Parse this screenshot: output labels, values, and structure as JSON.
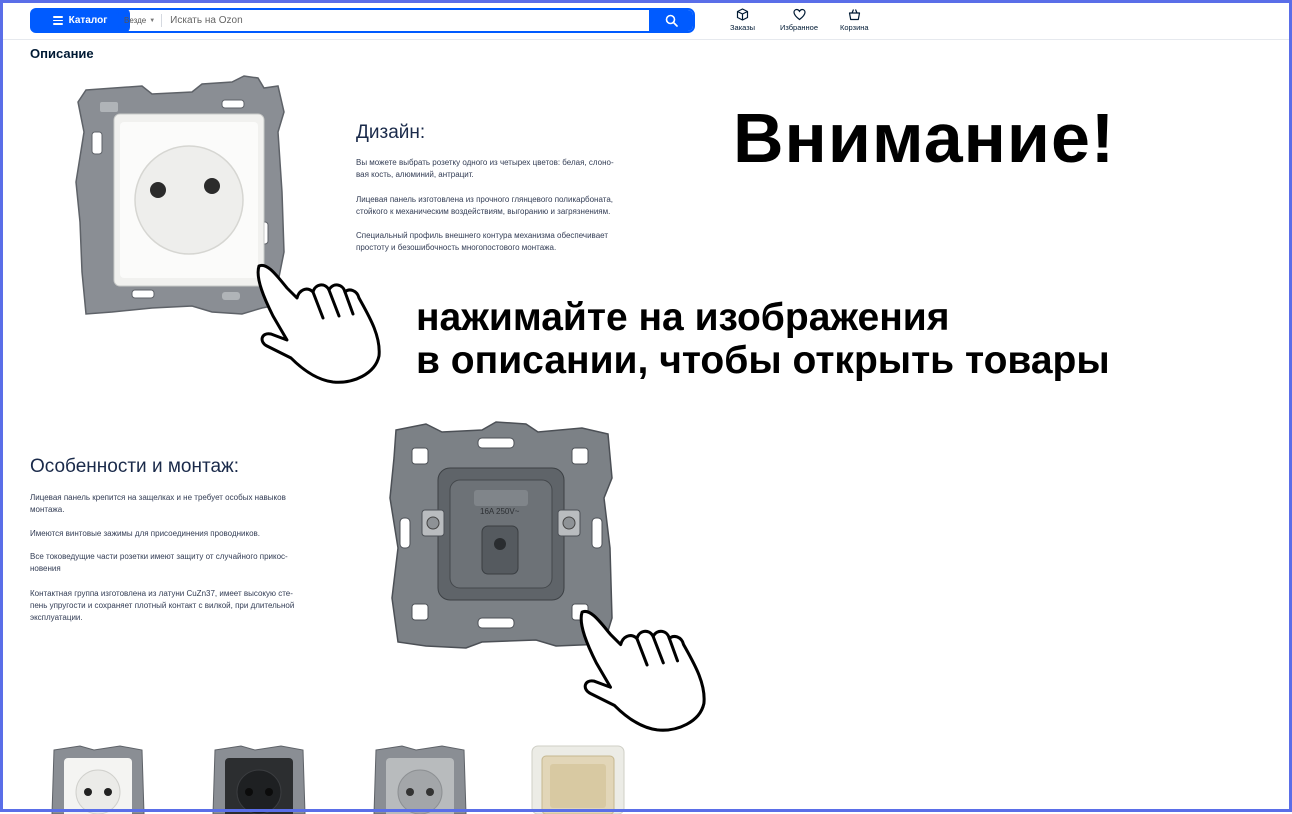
{
  "header": {
    "catalog_label": "Каталог",
    "search_scope": "Везде",
    "search_placeholder": "Искать на Ozon",
    "nav": {
      "orders": "Заказы",
      "favorites": "Избранное",
      "cart": "Корзина"
    }
  },
  "description": {
    "section_title": "Описание",
    "design": {
      "title": "Дизайн:",
      "paragraphs": [
        [
          "Вы можете выбрать розетку одного из четырех цветов: белая, слоно-",
          "вая кость, алюминий, антрацит."
        ],
        [
          "Лицевая панель изготовлена из прочного глянцевого поликарбоната,",
          "стойкого к механическим воздействиям, выгоранию и загрязнениям."
        ],
        [
          "Специальный профиль внешнего контура механизма обеспечивает",
          "простоту и безошибочность многопостового монтажа."
        ]
      ]
    },
    "features": {
      "title": "Особенности и монтаж:",
      "paragraphs": [
        [
          "Лицевая панель крепится на защелках и не требует особых навыков",
          "монтажа."
        ],
        [
          "Имеются винтовые зажимы для присоединения проводников."
        ],
        [
          "Все токоведущие части розетки имеют защиту от случайного прикос-",
          "новения"
        ],
        [
          "Контактная группа изготовлена из латуни CuZn37, имеет высокую сте-",
          "пень упругости и сохраняет плотный контакт с вилкой, при длительной",
          "эксплуатации."
        ]
      ]
    },
    "mechanism_label": "16A 250V~"
  },
  "overlay": {
    "attention": "Внимание!",
    "line1": "нажимайте на изображения",
    "line2": "в описании, чтобы открыть товары"
  },
  "colors": {
    "brand": "#005bff",
    "frame": "#5a6ee8",
    "frame_gray": "#8a8e94",
    "mechanism_gray": "#6e7378",
    "text_dark": "#001a34"
  },
  "thumbnails": [
    "white",
    "anthracite",
    "aluminium",
    "ivory"
  ]
}
